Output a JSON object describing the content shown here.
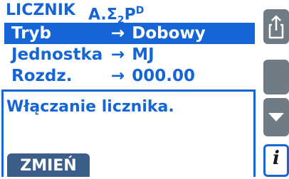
{
  "header": {
    "left": "LICZNIK",
    "right_prefix": "A.Σ",
    "right_sub": "2",
    "right_main": "P",
    "right_sup": "D"
  },
  "params": [
    {
      "label": "Tryb",
      "arrow": "→",
      "value": "Dobowy",
      "selected": true
    },
    {
      "label": "Jednostka",
      "arrow": "→",
      "value": "MJ",
      "selected": false
    },
    {
      "label": "Rozdz.",
      "arrow": "→",
      "value": "000.00",
      "selected": false
    }
  ],
  "help": {
    "text": "Włączanie licznika."
  },
  "softkey": {
    "label": "ZMIEŃ"
  },
  "side_buttons": {
    "export_icon": "export-icon",
    "down_icon": "triangle-down-icon",
    "info_label": "i"
  },
  "colors": {
    "accent": "#1565d6",
    "button_gray": "#6f7c85",
    "softkey": "#3c5f8a",
    "background": "#ffffff"
  }
}
